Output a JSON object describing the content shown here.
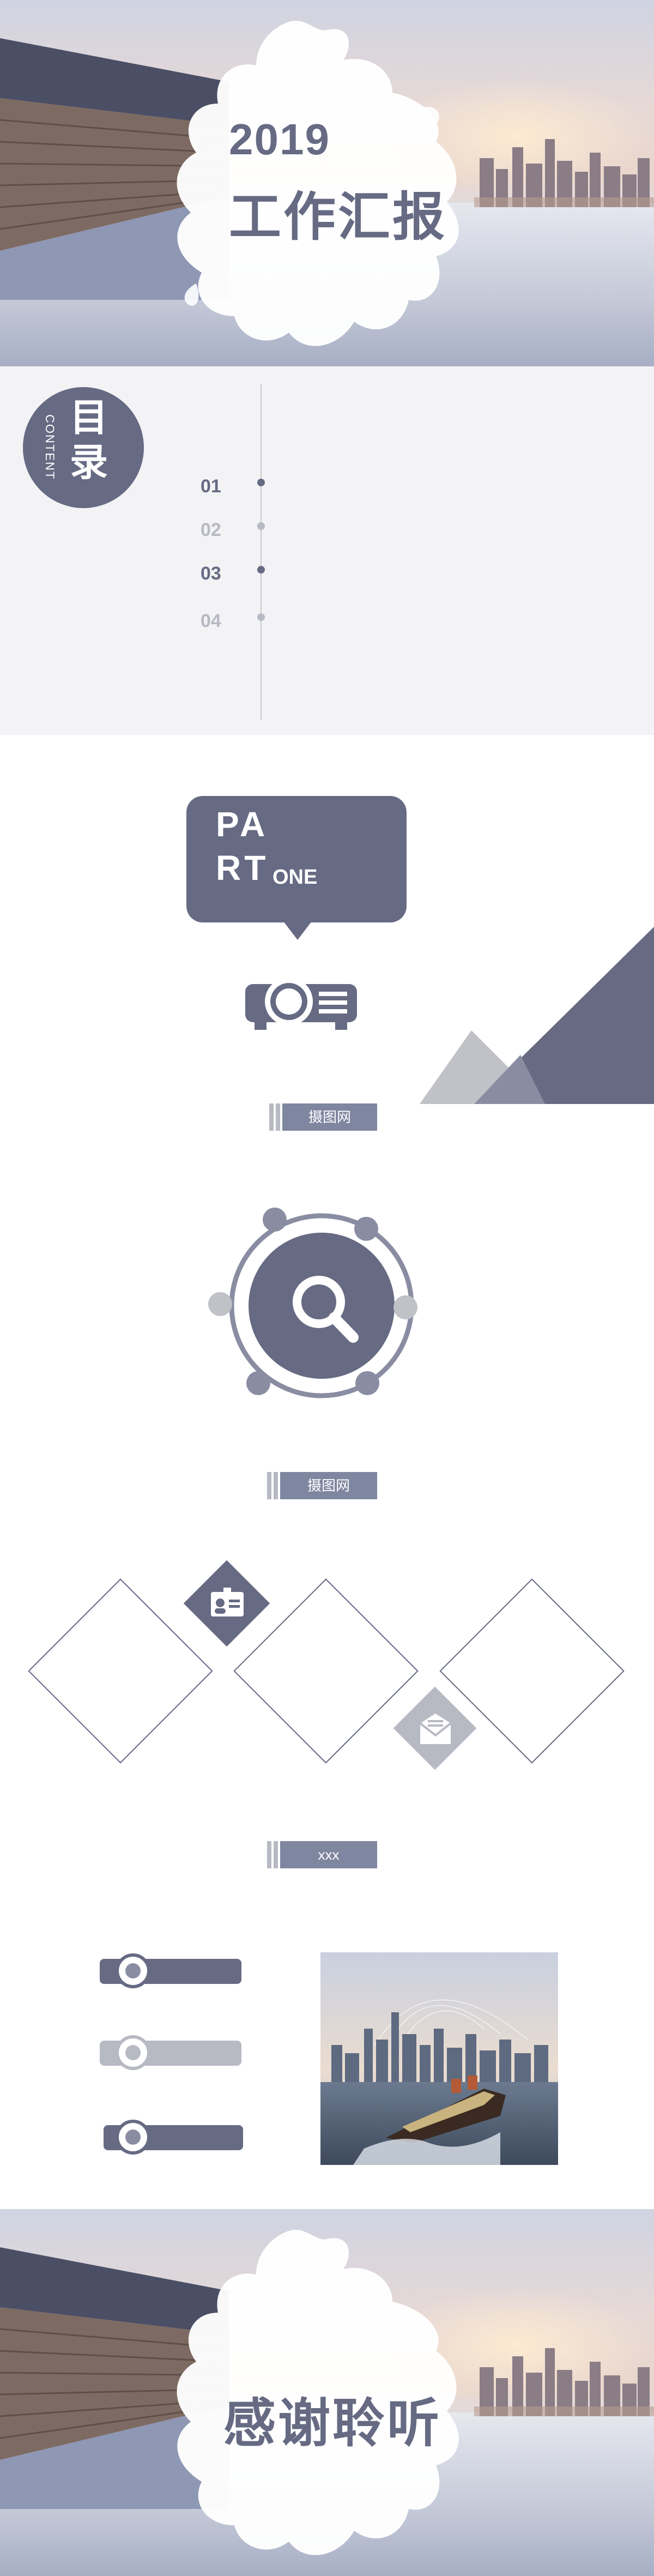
{
  "cover": {
    "year": "2019",
    "title": "工作汇报"
  },
  "toc": {
    "heading": "目录",
    "subheading": "CONTENT",
    "items": [
      "01",
      "02",
      "03",
      "04"
    ]
  },
  "part_one": {
    "line1": "PA",
    "line2": "RT",
    "suffix": "ONE",
    "label": "摄图网",
    "projector_icon": "projector-icon"
  },
  "search_section": {
    "label": "摄图网",
    "center_icon": "search-icon",
    "orbit_icons": [
      "calendar-icon",
      "megaphone-icon",
      "chat-icon",
      "calendar-icon",
      "megaphone-icon",
      "search-icon"
    ]
  },
  "diamond_section": {
    "label": "xxx",
    "icons": [
      "id-card-icon",
      "mail-icon"
    ]
  },
  "list_section": {
    "items": [
      {
        "style": "dark"
      },
      {
        "style": "light"
      },
      {
        "style": "dark"
      }
    ],
    "photo": "ship-city-photo"
  },
  "thanks": {
    "title": "感谢聆听"
  },
  "colors": {
    "primary": "#666a83",
    "accent": "#7e86a0",
    "light": "#b7b9c3",
    "toc_bg": "#f3f3f5"
  }
}
